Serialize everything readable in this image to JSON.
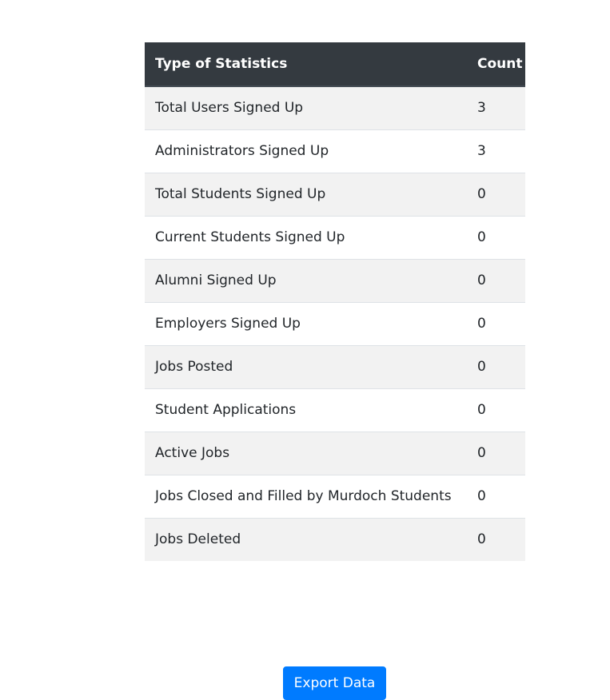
{
  "table": {
    "headers": {
      "type": "Type of Statistics",
      "count": "Count"
    },
    "rows": [
      {
        "label": "Total Users Signed Up",
        "count": "3"
      },
      {
        "label": "Administrators Signed Up",
        "count": "3"
      },
      {
        "label": "Total Students Signed Up",
        "count": "0"
      },
      {
        "label": "Current Students Signed Up",
        "count": "0"
      },
      {
        "label": "Alumni Signed Up",
        "count": "0"
      },
      {
        "label": "Employers Signed Up",
        "count": "0"
      },
      {
        "label": "Jobs Posted",
        "count": "0"
      },
      {
        "label": "Student Applications",
        "count": "0"
      },
      {
        "label": "Active Jobs",
        "count": "0"
      },
      {
        "label": "Jobs Closed and Filled by Murdoch Students",
        "count": "0"
      },
      {
        "label": "Jobs Deleted",
        "count": "0"
      }
    ]
  },
  "actions": {
    "export_label": "Export Data"
  },
  "colors": {
    "header_bg": "#343a40",
    "stripe_bg": "#f2f2f2",
    "primary_button": "#007bff"
  }
}
